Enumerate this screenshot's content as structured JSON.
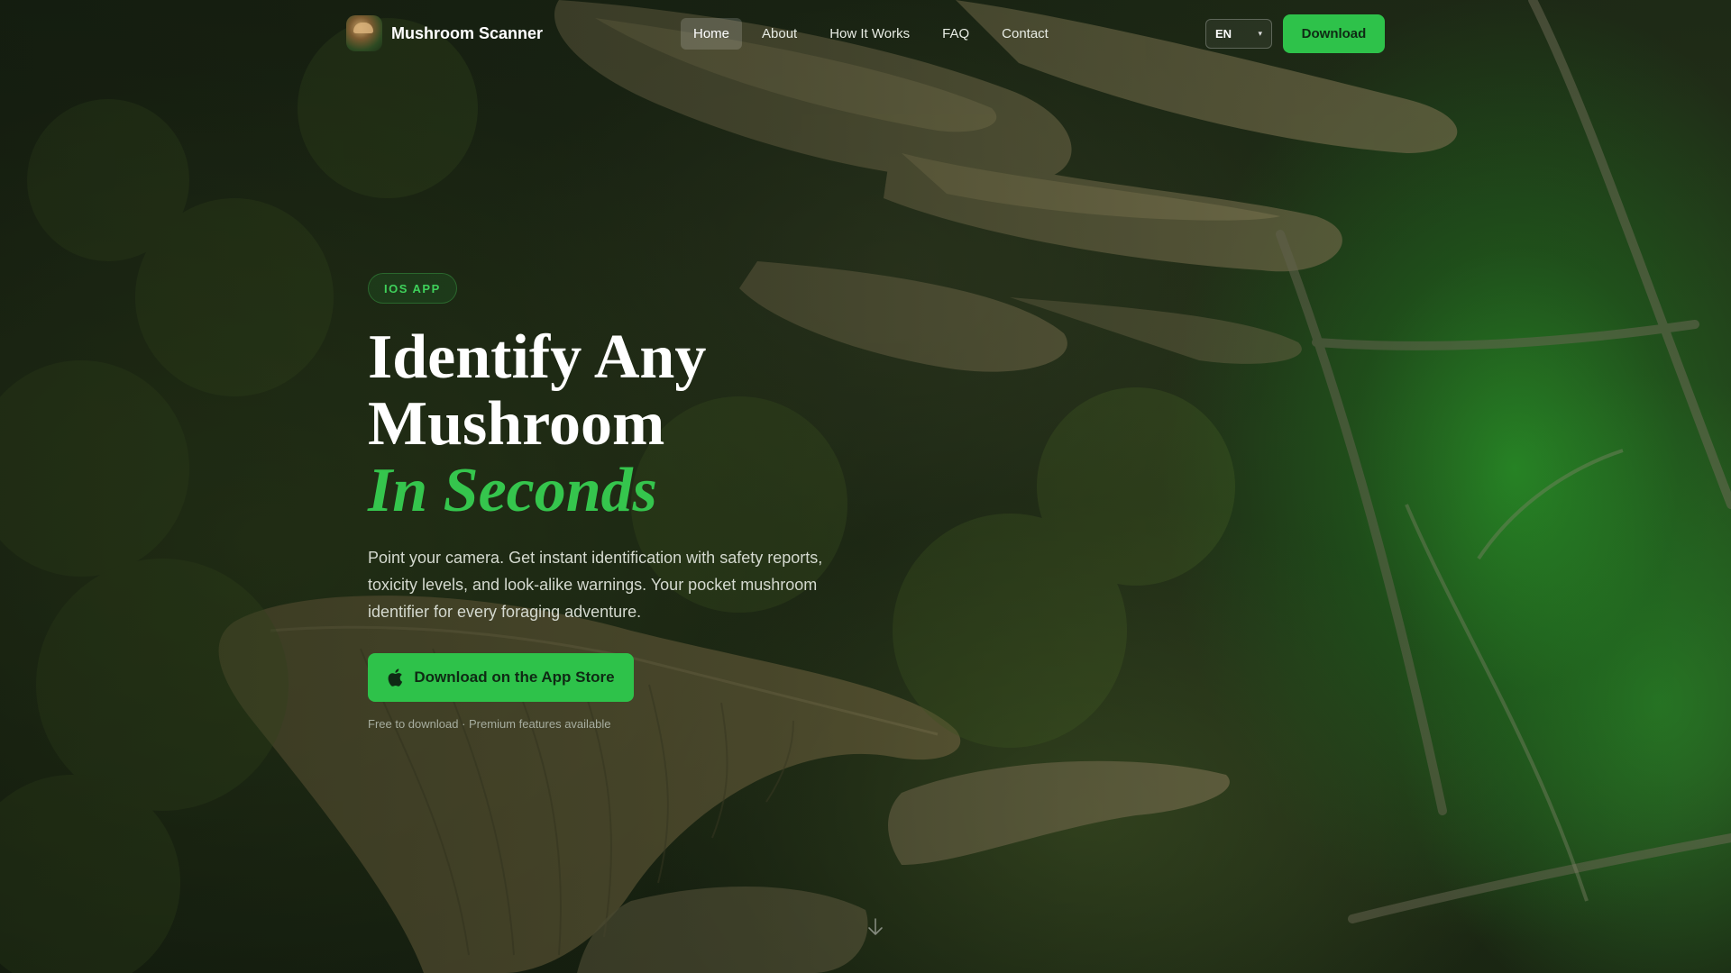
{
  "brand": {
    "name": "Mushroom Scanner",
    "logo_icon": "mushroom-logo-icon"
  },
  "nav": {
    "items": [
      {
        "label": "Home",
        "active": true
      },
      {
        "label": "About",
        "active": false
      },
      {
        "label": "How It Works",
        "active": false
      },
      {
        "label": "FAQ",
        "active": false
      },
      {
        "label": "Contact",
        "active": false
      }
    ],
    "language": "EN",
    "download_label": "Download"
  },
  "hero": {
    "badge": "IOS APP",
    "headline_line1": "Identify Any",
    "headline_line2": "Mushroom",
    "headline_accent": "In Seconds",
    "description": "Point your camera. Get instant identification with safety reports, toxicity levels, and look-alike warnings. Your pocket mushroom identifier for every foraging adventure.",
    "cta_label": "Download on the App Store",
    "cta_icon": "apple-icon",
    "note": "Free to download · Premium features available",
    "scroll_icon": "arrow-down-icon"
  },
  "colors": {
    "accent": "#2ec24a",
    "accent_text": "#35c54d",
    "button_text": "#0f2a14"
  }
}
